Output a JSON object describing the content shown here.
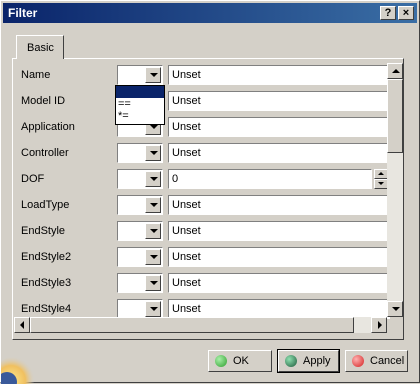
{
  "window": {
    "title": "Filter",
    "help_label": "?",
    "close_label": "×"
  },
  "tabs": [
    {
      "label": "Basic"
    }
  ],
  "rows": [
    {
      "label": "Name",
      "value": "Unset"
    },
    {
      "label": "Model ID",
      "value": "Unset"
    },
    {
      "label": "Application",
      "value": "Unset"
    },
    {
      "label": "Controller",
      "value": "Unset"
    },
    {
      "label": "DOF",
      "value": "0"
    },
    {
      "label": "LoadType",
      "value": "Unset"
    },
    {
      "label": "EndStyle",
      "value": "Unset"
    },
    {
      "label": "EndStyle2",
      "value": "Unset"
    },
    {
      "label": "EndStyle3",
      "value": "Unset"
    },
    {
      "label": "EndStyle4",
      "value": "Unset"
    }
  ],
  "operator_dropdown": {
    "options": [
      "",
      "==",
      "*="
    ],
    "selected_index": 0
  },
  "buttons": {
    "ok": "OK",
    "apply": "Apply",
    "cancel": "Cancel"
  },
  "colors": {
    "ok_icon": "#2e9e2e",
    "apply_icon": "#1c5a3a",
    "cancel_icon": "#d42020",
    "title_bar": "#0a246a"
  },
  "icons": {
    "ok": "green-circle-icon",
    "apply": "dark-green-circle-icon",
    "cancel": "red-circle-icon",
    "logo": "globe-logo-icon"
  }
}
